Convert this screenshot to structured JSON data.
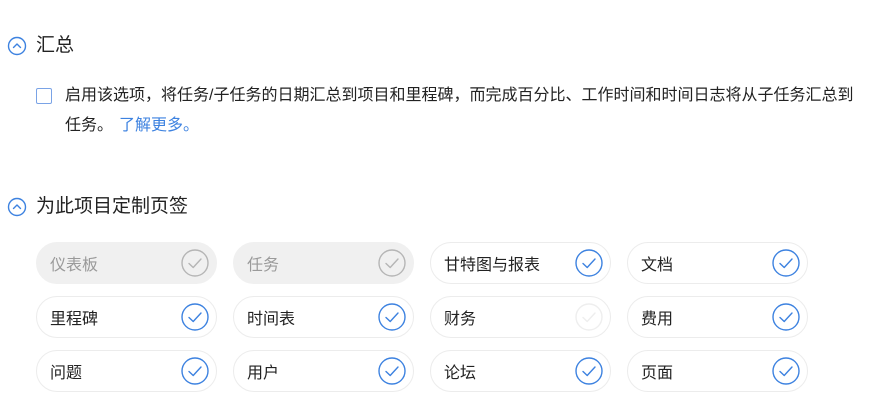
{
  "summary_section": {
    "title": "汇总",
    "option_text": "启用该选项，将任务/子任务的日期汇总到项目和里程碑，而完成百分比、工作时间和时间日志将从子任务汇总到任务。",
    "learn_more": "了解更多。",
    "checked": false
  },
  "tabs_section": {
    "title": "为此项目定制页签",
    "tabs": [
      {
        "label": "仪表板",
        "state": "locked"
      },
      {
        "label": "任务",
        "state": "locked"
      },
      {
        "label": "甘特图与报表",
        "state": "checked"
      },
      {
        "label": "文档",
        "state": "checked"
      },
      {
        "label": "里程碑",
        "state": "checked"
      },
      {
        "label": "时间表",
        "state": "checked"
      },
      {
        "label": "财务",
        "state": "unchecked"
      },
      {
        "label": "费用",
        "state": "checked"
      },
      {
        "label": "问题",
        "state": "checked"
      },
      {
        "label": "用户",
        "state": "checked"
      },
      {
        "label": "论坛",
        "state": "checked"
      },
      {
        "label": "页面",
        "state": "checked"
      }
    ]
  },
  "colors": {
    "accent": "#3d82e0",
    "locked_check": "#b5b5b5",
    "unchecked_check": "#eeeeee"
  },
  "icons": {
    "section_toggle": "chevron-up-circle-icon",
    "tab_check": "check-circle-icon"
  }
}
